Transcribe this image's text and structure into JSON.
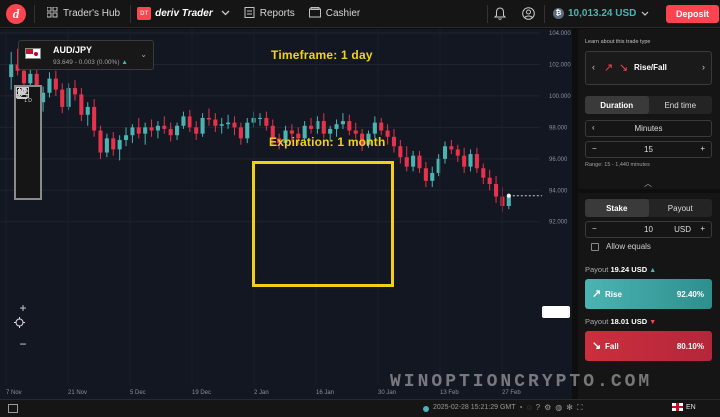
{
  "header": {
    "hub_label": "Trader's Hub",
    "app_label": "deriv Trader",
    "app_badge": "DT",
    "reports_label": "Reports",
    "cashier_label": "Cashier",
    "balance": "10,013.24 USD",
    "deposit_label": "Deposit"
  },
  "symbol": {
    "name": "AUD/JPY",
    "price": "93.649 - 0.003 (0.00%)"
  },
  "overlays": {
    "timeframe": "Timeframe: 1 day",
    "expiration": "Expiration: 1 month"
  },
  "chart_data": {
    "type": "candlestick",
    "ylim": [
      82,
      104
    ],
    "y_ticks": [
      "104.000",
      "102.000",
      "100.000",
      "98.000",
      "96.000",
      "94.000",
      "92.000"
    ],
    "x_ticks": [
      "7 Nov",
      "21 Nov",
      "5 Dec",
      "19 Dec",
      "2 Jan",
      "16 Jan",
      "30 Jan",
      "13 Feb",
      "27 Feb"
    ],
    "up_color": "#4bb4b3",
    "down_color": "#e6334b",
    "candles": [
      [
        101.2,
        102.8,
        100.4,
        102.0
      ],
      [
        102.0,
        103.0,
        101.3,
        101.6
      ],
      [
        101.6,
        102.2,
        100.4,
        100.8
      ],
      [
        100.8,
        101.9,
        99.8,
        101.4
      ],
      [
        101.4,
        101.8,
        99.2,
        99.6
      ],
      [
        99.6,
        100.6,
        99.0,
        100.2
      ],
      [
        100.2,
        101.5,
        99.9,
        101.1
      ],
      [
        101.1,
        101.6,
        100.0,
        100.4
      ],
      [
        100.4,
        100.8,
        98.9,
        99.3
      ],
      [
        99.3,
        100.8,
        99.1,
        100.5
      ],
      [
        100.5,
        101.0,
        99.7,
        100.1
      ],
      [
        100.1,
        100.5,
        98.4,
        98.8
      ],
      [
        98.8,
        99.6,
        98.1,
        99.3
      ],
      [
        99.3,
        99.8,
        97.4,
        97.8
      ],
      [
        97.8,
        98.1,
        96.0,
        96.4
      ],
      [
        96.4,
        97.6,
        96.1,
        97.3
      ],
      [
        97.3,
        97.7,
        96.2,
        96.6
      ],
      [
        96.6,
        97.5,
        95.9,
        97.2
      ],
      [
        97.2,
        98.0,
        96.8,
        97.5
      ],
      [
        97.5,
        98.2,
        97.0,
        98.0
      ],
      [
        98.0,
        98.6,
        97.3,
        97.6
      ],
      [
        97.6,
        98.3,
        96.9,
        98.0
      ],
      [
        98.0,
        98.5,
        97.4,
        97.8
      ],
      [
        97.8,
        98.4,
        97.3,
        98.1
      ],
      [
        98.1,
        98.7,
        97.6,
        97.9
      ],
      [
        97.9,
        98.3,
        97.1,
        97.5
      ],
      [
        97.5,
        98.3,
        97.2,
        98.1
      ],
      [
        98.1,
        99.0,
        97.9,
        98.7
      ],
      [
        98.7,
        99.1,
        97.7,
        98.0
      ],
      [
        98.0,
        98.4,
        97.2,
        97.6
      ],
      [
        97.6,
        98.9,
        97.4,
        98.6
      ],
      [
        98.6,
        99.2,
        98.1,
        98.5
      ],
      [
        98.5,
        98.9,
        97.7,
        98.1
      ],
      [
        98.1,
        98.6,
        97.6,
        98.2
      ],
      [
        98.2,
        98.8,
        97.9,
        98.3
      ],
      [
        98.3,
        98.7,
        97.5,
        98.0
      ],
      [
        98.0,
        98.3,
        96.9,
        97.3
      ],
      [
        97.3,
        98.6,
        97.0,
        98.3
      ],
      [
        98.3,
        99.0,
        98.0,
        98.6
      ],
      [
        98.6,
        98.9,
        98.1,
        98.6
      ],
      [
        98.6,
        99.0,
        97.8,
        98.1
      ],
      [
        98.1,
        98.5,
        96.9,
        97.3
      ],
      [
        97.3,
        97.6,
        96.6,
        97.0
      ],
      [
        97.0,
        98.1,
        96.8,
        97.8
      ],
      [
        97.8,
        98.2,
        97.1,
        97.6
      ],
      [
        97.6,
        98.0,
        96.9,
        97.3
      ],
      [
        97.3,
        98.4,
        97.2,
        98.1
      ],
      [
        98.1,
        98.6,
        97.6,
        97.9
      ],
      [
        97.9,
        98.7,
        97.6,
        98.4
      ],
      [
        98.4,
        98.9,
        97.3,
        97.6
      ],
      [
        97.6,
        98.1,
        97.1,
        97.9
      ],
      [
        97.9,
        98.5,
        97.4,
        98.2
      ],
      [
        98.2,
        98.9,
        97.9,
        98.4
      ],
      [
        98.4,
        98.8,
        97.5,
        97.8
      ],
      [
        97.8,
        98.3,
        97.3,
        97.6
      ],
      [
        97.6,
        97.9,
        96.5,
        96.9
      ],
      [
        96.9,
        97.8,
        96.7,
        97.6
      ],
      [
        97.6,
        98.7,
        97.3,
        98.3
      ],
      [
        98.3,
        98.6,
        97.5,
        97.8
      ],
      [
        97.8,
        98.2,
        96.9,
        97.4
      ],
      [
        97.4,
        97.9,
        96.4,
        96.8
      ],
      [
        96.8,
        97.2,
        95.7,
        96.1
      ],
      [
        96.1,
        96.8,
        95.2,
        95.5
      ],
      [
        95.5,
        96.5,
        95.2,
        96.2
      ],
      [
        96.2,
        96.5,
        95.1,
        95.4
      ],
      [
        95.4,
        95.8,
        94.2,
        94.6
      ],
      [
        94.6,
        95.5,
        94.2,
        95.1
      ],
      [
        95.1,
        96.3,
        94.9,
        96.0
      ],
      [
        96.0,
        97.1,
        95.7,
        96.8
      ],
      [
        96.8,
        97.2,
        96.3,
        96.6
      ],
      [
        96.6,
        96.9,
        95.8,
        96.2
      ],
      [
        96.2,
        96.7,
        95.1,
        95.5
      ],
      [
        95.5,
        96.6,
        95.2,
        96.3
      ],
      [
        96.3,
        96.7,
        95.1,
        95.4
      ],
      [
        95.4,
        95.7,
        94.4,
        94.8
      ],
      [
        94.8,
        95.3,
        94.0,
        94.4
      ],
      [
        94.4,
        94.9,
        93.2,
        93.6
      ],
      [
        93.6,
        94.2,
        92.6,
        93.0
      ],
      [
        93.0,
        93.8,
        92.8,
        93.649
      ]
    ]
  },
  "toolbar": {
    "interval_label": "1 D",
    "zoom_in": "+",
    "zoom_out": "−"
  },
  "panel": {
    "learn_label": "Learn about this trade type",
    "trade_type": "Rise/Fall",
    "duration_tab": "Duration",
    "endtime_tab": "End time",
    "unit": "Minutes",
    "duration_value": "15",
    "range_hint": "Range: 15 - 1,440 minutes",
    "stake_tab": "Stake",
    "payout_tab": "Payout",
    "stake_value": "10",
    "currency": "USD",
    "allow_equals": "Allow equals",
    "rise_payout_label": "Payout",
    "rise_payout": "19.24 USD",
    "rise_label": "Rise",
    "rise_pct": "92.40%",
    "fall_payout_label": "Payout",
    "fall_payout": "18.01 USD",
    "fall_label": "Fall",
    "fall_pct": "80.10%",
    "rise_color": "#4bb4b3",
    "fall_color": "#cc2e3d"
  },
  "footer": {
    "time": "2025-02-28 15:21:29 GMT",
    "lang": "EN"
  },
  "watermark": "WINOPTIONCRYPTO.COM"
}
